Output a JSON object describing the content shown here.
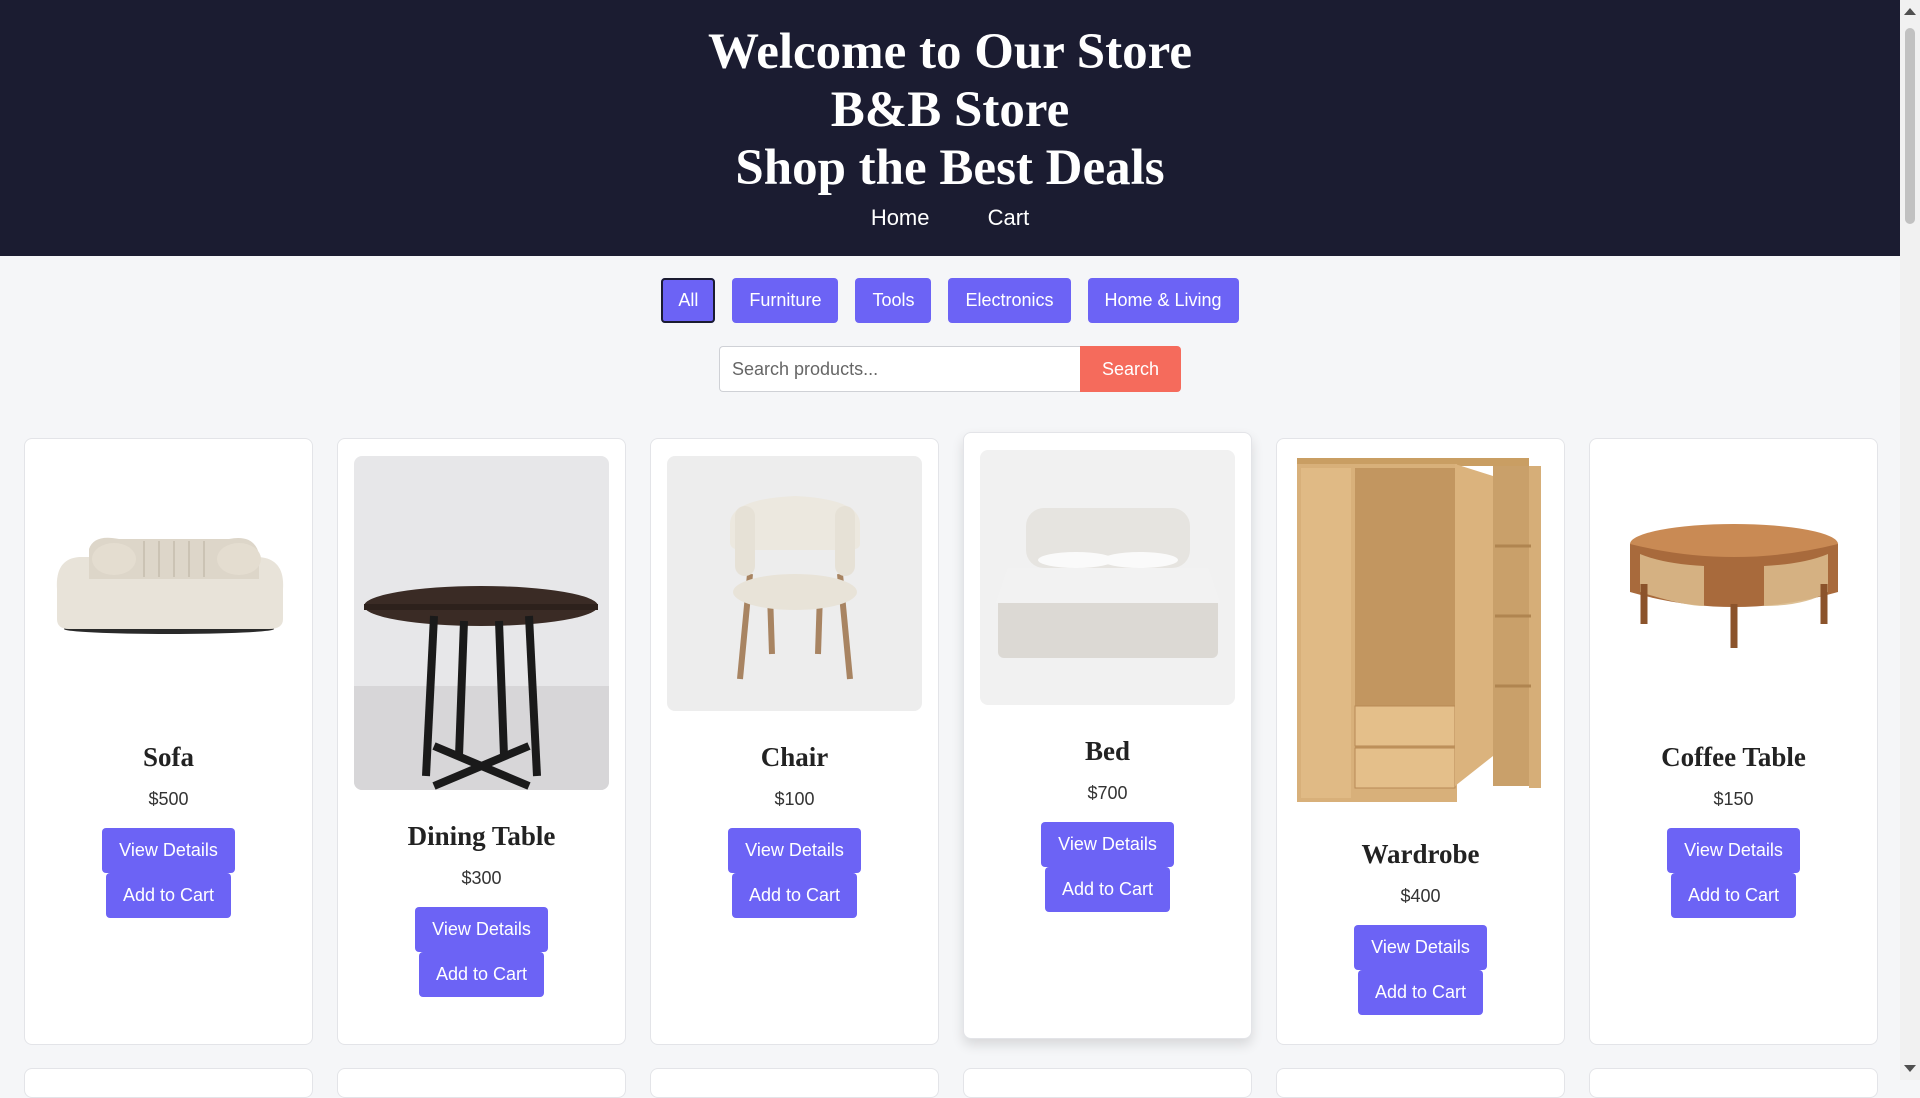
{
  "header": {
    "title_line1": "Welcome to Our Store",
    "title_line2": "B&B Store",
    "title_line3": "Shop the Best Deals",
    "nav": {
      "home": "Home",
      "cart": "Cart"
    },
    "background": "#1b1c31"
  },
  "filters": {
    "items": [
      "All",
      "Furniture",
      "Tools",
      "Electronics",
      "Home & Living"
    ],
    "active": "All",
    "color": "#6c63f5"
  },
  "search": {
    "placeholder": "Search products...",
    "value": "",
    "button_label": "Search",
    "button_color": "#f56b5c"
  },
  "products": [
    {
      "name": "Sofa",
      "price": "$500",
      "view_label": "View Details",
      "add_label": "Add to Cart",
      "icon": "sofa-image"
    },
    {
      "name": "Dining Table",
      "price": "$300",
      "view_label": "View Details",
      "add_label": "Add to Cart",
      "icon": "dining-table-image"
    },
    {
      "name": "Chair",
      "price": "$100",
      "view_label": "View Details",
      "add_label": "Add to Cart",
      "icon": "chair-image"
    },
    {
      "name": "Bed",
      "price": "$700",
      "view_label": "View Details",
      "add_label": "Add to Cart",
      "icon": "bed-image"
    },
    {
      "name": "Wardrobe",
      "price": "$400",
      "view_label": "View Details",
      "add_label": "Add to Cart",
      "icon": "wardrobe-image"
    },
    {
      "name": "Coffee Table",
      "price": "$150",
      "view_label": "View Details",
      "add_label": "Add to Cart",
      "icon": "coffee-table-image"
    }
  ]
}
